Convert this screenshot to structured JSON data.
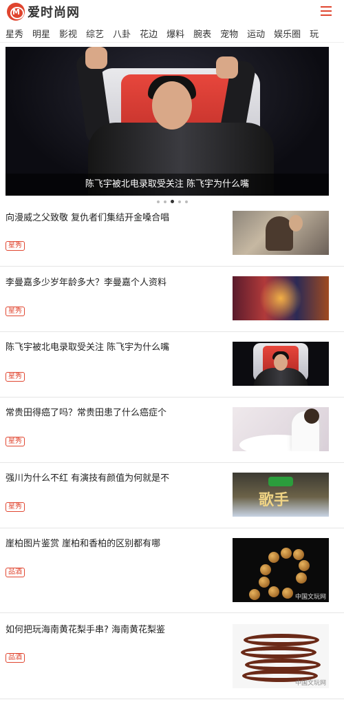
{
  "header": {
    "logo_text": "爱时尚网",
    "logo_glyph": "M"
  },
  "nav": {
    "items": [
      "星秀",
      "明星",
      "影视",
      "综艺",
      "八卦",
      "花边",
      "爆料",
      "腕表",
      "宠物",
      "运动",
      "娱乐圈",
      "玩"
    ]
  },
  "banner": {
    "caption": "陈飞宇被北电录取受关注 陈飞宇为什么嘴",
    "slides": 5,
    "active_slide": 3
  },
  "articles": [
    {
      "title": "向漫威之父致敬 复仇者们集结开金嗓合唱",
      "tag": "星秀"
    },
    {
      "title": "李曼嘉多少岁年龄多大？李曼嘉个人资料",
      "tag": "星秀"
    },
    {
      "title": "陈飞宇被北电录取受关注 陈飞宇为什么嘴",
      "tag": "星秀"
    },
    {
      "title": "常贵田得癌了吗？常贵田患了什么癌症个",
      "tag": "星秀"
    },
    {
      "title": "强川为什么不红 有演技有颜值为何就是不",
      "tag": "星秀"
    },
    {
      "title": "崖柏图片鉴赏   崖柏和香柏的区别都有哪",
      "tag": "品酒"
    },
    {
      "title": "如何把玩海南黄花梨手串? 海南黄花梨鉴",
      "tag": "品酒"
    }
  ],
  "thumbs": {
    "t5_word": "歌手",
    "watermark": "中国文玩网"
  },
  "colors": {
    "accent": "#e0452f",
    "divider": "#e5e5e5"
  }
}
